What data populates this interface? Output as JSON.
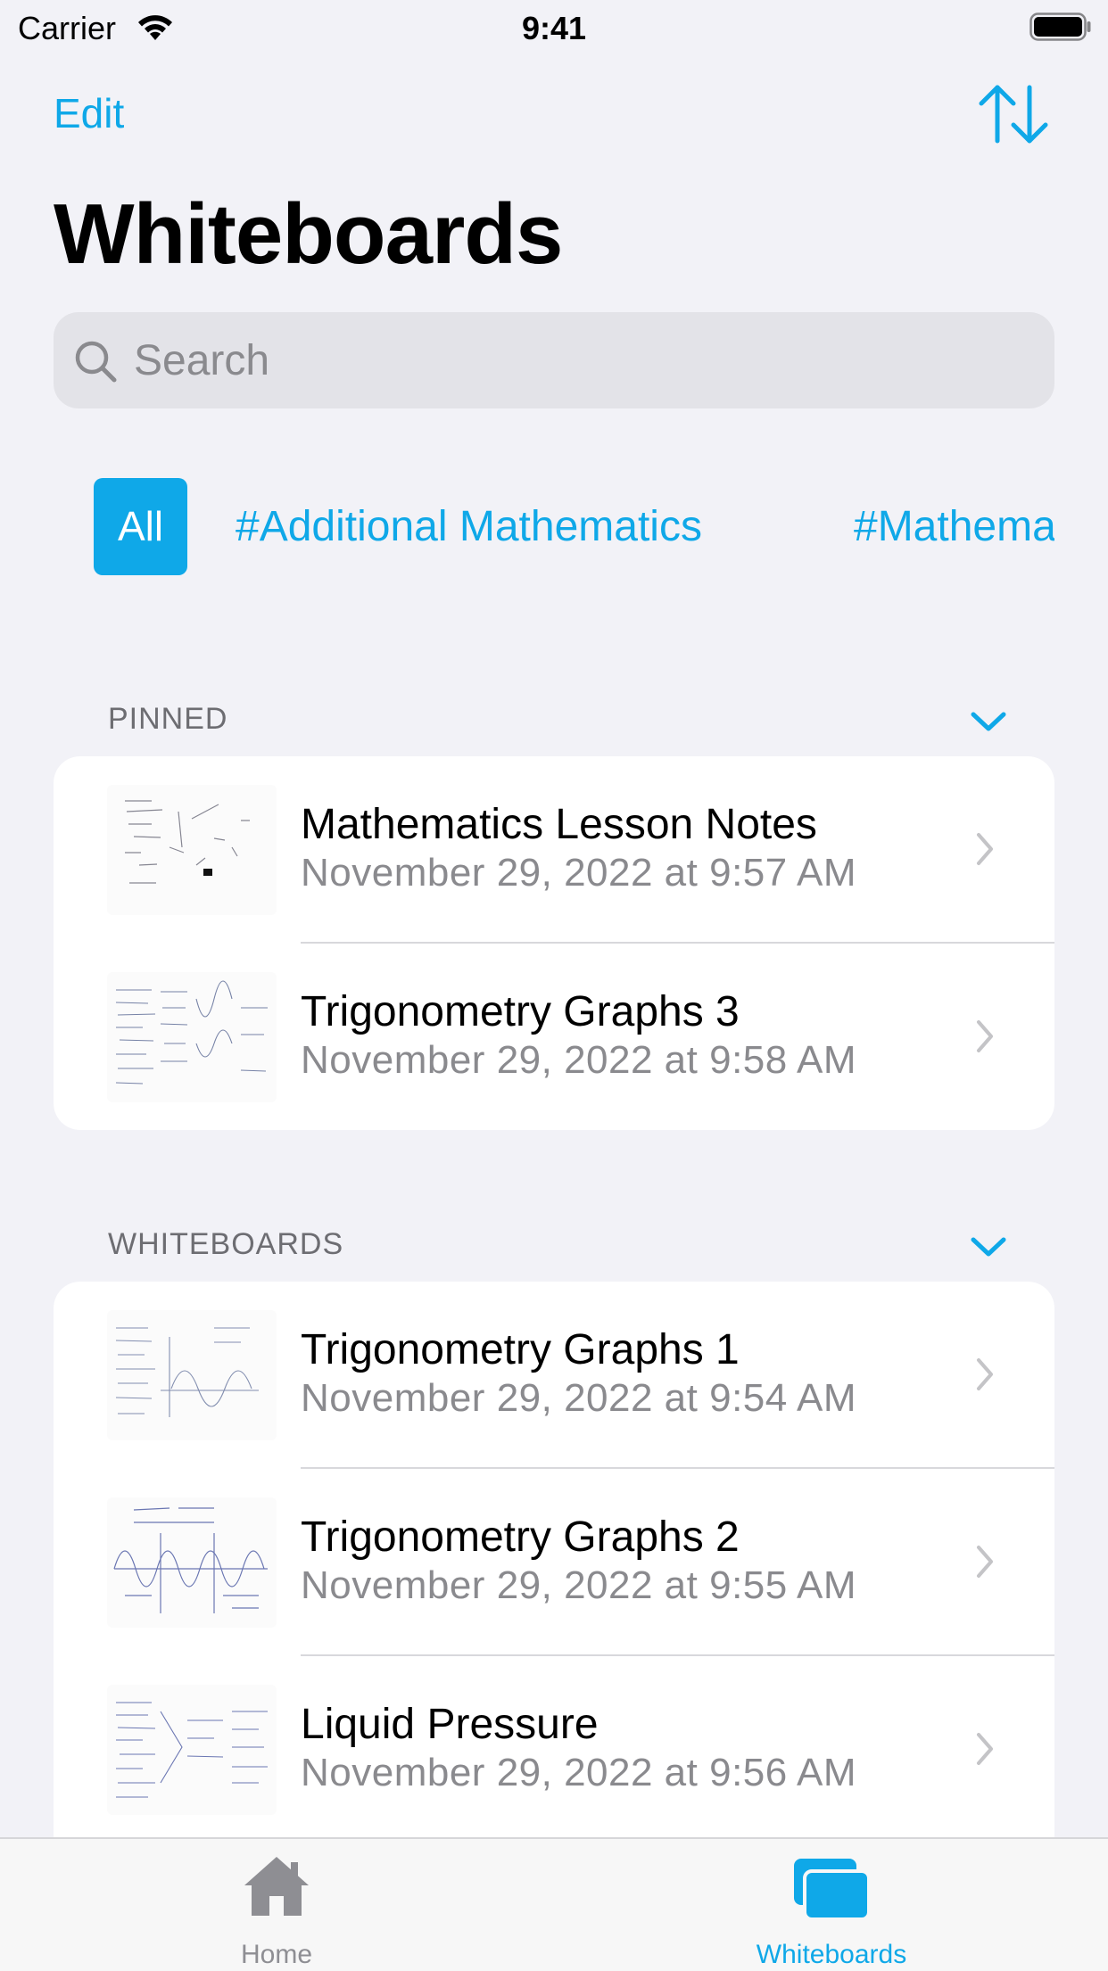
{
  "status_bar": {
    "carrier": "Carrier",
    "time": "9:41"
  },
  "nav": {
    "edit_label": "Edit",
    "sort_icon": "sort-arrows-icon"
  },
  "page_title": "Whiteboards",
  "search": {
    "placeholder": "Search",
    "value": ""
  },
  "tags": {
    "all_label": "All",
    "items": [
      "#Additional Mathematics",
      "#Mathematics"
    ]
  },
  "pinned": {
    "header": "PINNED",
    "items": [
      {
        "title": "Mathematics Lesson Notes",
        "date": "November 29, 2022 at 9:57 AM"
      },
      {
        "title": "Trigonometry Graphs 3",
        "date": "November 29, 2022 at 9:58 AM"
      }
    ]
  },
  "whiteboards": {
    "header": "WHITEBOARDS",
    "items": [
      {
        "title": "Trigonometry Graphs 1",
        "date": "November 29, 2022 at 9:54 AM"
      },
      {
        "title": "Trigonometry Graphs 2",
        "date": "November 29, 2022 at 9:55 AM"
      },
      {
        "title": "Liquid Pressure",
        "date": "November 29, 2022 at 9:56 AM"
      }
    ]
  },
  "tab_bar": {
    "home_label": "Home",
    "whiteboards_label": "Whiteboards",
    "selected": "Whiteboards"
  },
  "colors": {
    "accent": "#0fa8e8",
    "background": "#f2f2f7",
    "secondary_text": "#8a8a8e",
    "inactive_tab": "#8e8e93"
  }
}
